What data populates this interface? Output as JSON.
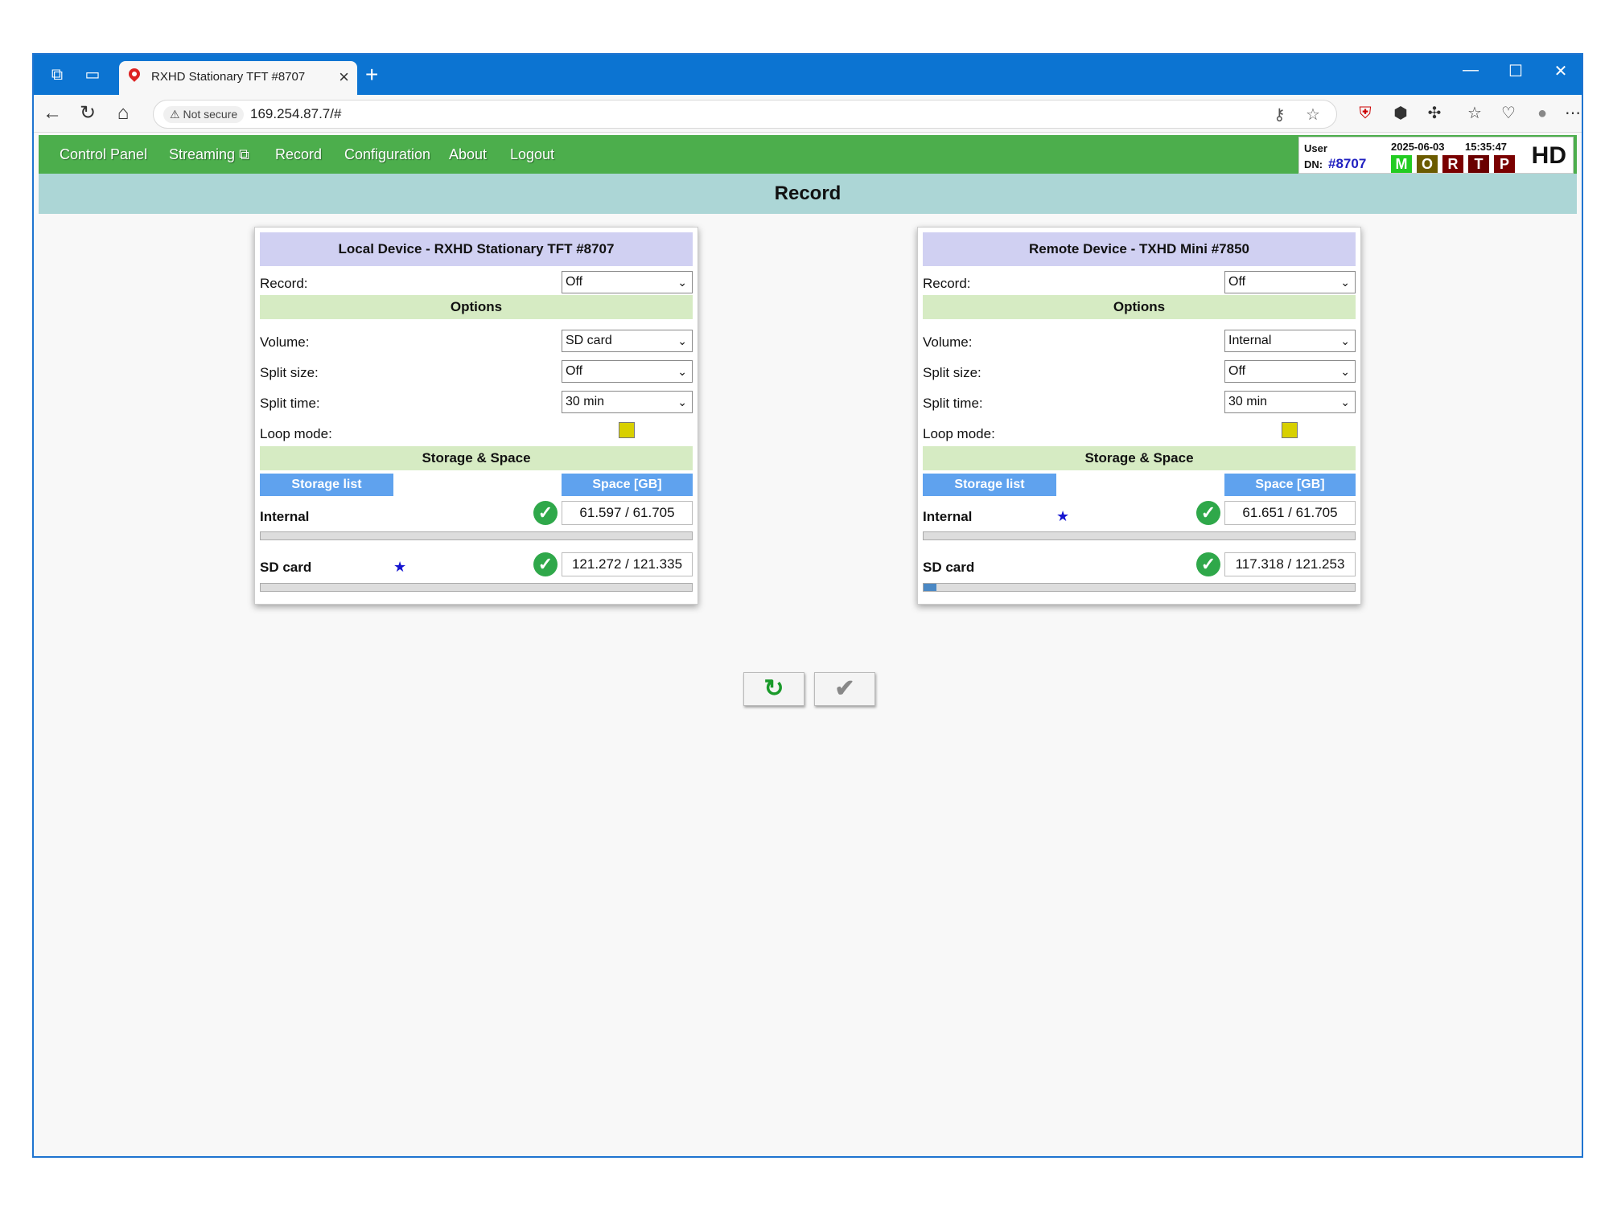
{
  "browser": {
    "tab_title": "RXHD Stationary TFT #8707",
    "not_secure": "Not secure",
    "url": "169.254.87.7/#"
  },
  "nav": {
    "items": [
      {
        "label": "Control Panel"
      },
      {
        "label": "Streaming"
      },
      {
        "label": "Record"
      },
      {
        "label": "Configuration"
      },
      {
        "label": "About"
      },
      {
        "label": "Logout"
      }
    ]
  },
  "status": {
    "user_label": "User",
    "dn_label": "DN:",
    "dn_value": "#8707",
    "date": "2025-06-03",
    "time": "15:35:47",
    "lamps": [
      {
        "letter": "M",
        "color": "#22cc22"
      },
      {
        "letter": "O",
        "color": "#6b5b00"
      },
      {
        "letter": "R",
        "color": "#7a0000"
      },
      {
        "letter": "T",
        "color": "#6a0000"
      },
      {
        "letter": "P",
        "color": "#7a0000"
      }
    ],
    "hd": "HD"
  },
  "page_title": "Record",
  "local": {
    "title": "Local Device - RXHD Stationary TFT #8707",
    "record_label": "Record:",
    "record_value": "Off",
    "options_label": "Options",
    "volume_label": "Volume:",
    "volume_value": "SD card",
    "split_size_label": "Split size:",
    "split_size_value": "Off",
    "split_time_label": "Split time:",
    "split_time_value": "30 min",
    "loop_label": "Loop mode:",
    "storage_label": "Storage & Space",
    "storage_list": "Storage list",
    "space_header": "Space [GB]",
    "storages": [
      {
        "name": "Internal",
        "space": "61.597 / 61.705",
        "used_fraction": 0.0
      },
      {
        "name": "SD card",
        "space": "121.272 / 121.335",
        "used_fraction": 0.0
      }
    ]
  },
  "remote": {
    "title": "Remote Device - TXHD Mini #7850",
    "record_label": "Record:",
    "record_value": "Off",
    "options_label": "Options",
    "volume_label": "Volume:",
    "volume_value": "Internal",
    "split_size_label": "Split size:",
    "split_size_value": "Off",
    "split_time_label": "Split time:",
    "split_time_value": "30 min",
    "loop_label": "Loop mode:",
    "storage_label": "Storage & Space",
    "storage_list": "Storage list",
    "space_header": "Space [GB]",
    "storages": [
      {
        "name": "Internal",
        "space": "61.651 / 61.705",
        "used_fraction": 0.0
      },
      {
        "name": "SD card",
        "space": "117.318 / 121.253",
        "used_fraction": 0.03
      }
    ]
  }
}
